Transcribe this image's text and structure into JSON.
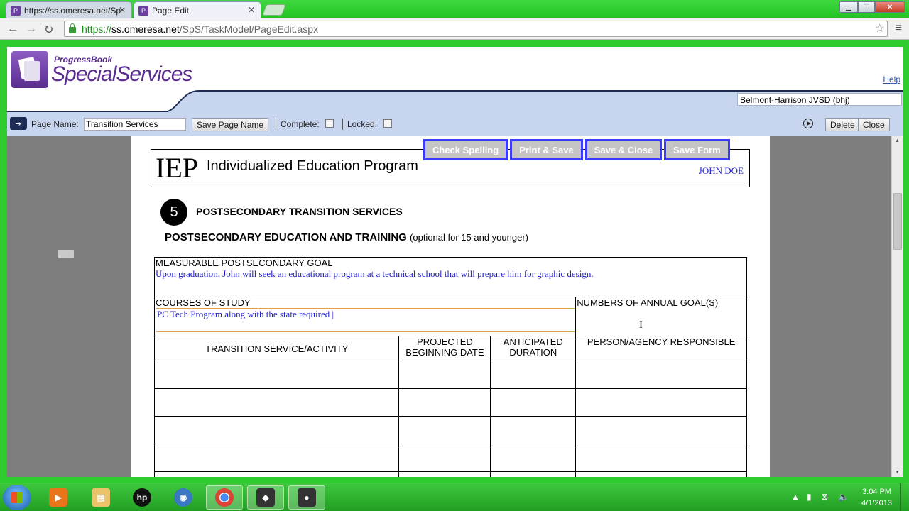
{
  "browser": {
    "tabs": [
      {
        "label": "https://ss.omeresa.net/Sp"
      },
      {
        "label": "Page Edit"
      }
    ],
    "url_scheme": "https://",
    "url_host": "ss.omeresa.net",
    "url_path": "/SpS/TaskModel/PageEdit.aspx"
  },
  "app": {
    "logo_small": "ProgressBook",
    "logo_big": "SpecialServices",
    "help_label": "Help",
    "district": "Belmont-Harrison JVSD (bhj)"
  },
  "toolbar": {
    "page_name_label": "Page Name:",
    "page_name_value": "Transition Services",
    "save_page_name_label": "Save Page Name",
    "complete_label": "Complete:",
    "locked_label": "Locked:",
    "delete_label": "Delete",
    "close_label": "Close"
  },
  "actions": {
    "check_spelling": "Check Spelling",
    "print_save": "Print & Save",
    "save_close": "Save & Close",
    "save_form": "Save Form"
  },
  "document": {
    "iep_mark": "IEP",
    "iep_title": "Individualized Education Program",
    "student_name": "JOHN DOE",
    "section_number": "5",
    "section_title": "POSTSECONDARY TRANSITION SERVICES",
    "subsection_title": "POSTSECONDARY EDUCATION AND TRAINING",
    "subsection_note": "(optional for 15 and younger)",
    "goal_header": "MEASURABLE POSTSECONDARY GOAL",
    "goal_value": "Upon graduation, John will seek an educational program at a technical school that will prepare him for graphic design.",
    "courses_header": "COURSES OF STUDY",
    "courses_value": "PC Tech Program along with the state required |",
    "annual_goals_header": "NUMBERS OF ANNUAL GOAL(S)",
    "col_service": "TRANSITION SERVICE/ACTIVITY",
    "col_begin": "PROJECTED BEGINNING DATE",
    "col_duration": "ANTICIPATED DURATION",
    "col_person": "PERSON/AGENCY RESPONSIBLE"
  },
  "taskbar": {
    "time": "3:04 PM",
    "date": "4/1/2013"
  },
  "colors": {
    "accent_purple": "#5b2d8e",
    "toolbar_blue": "#c7d5ef",
    "action_border": "#3b3bff",
    "value_blue": "#2222cc"
  }
}
